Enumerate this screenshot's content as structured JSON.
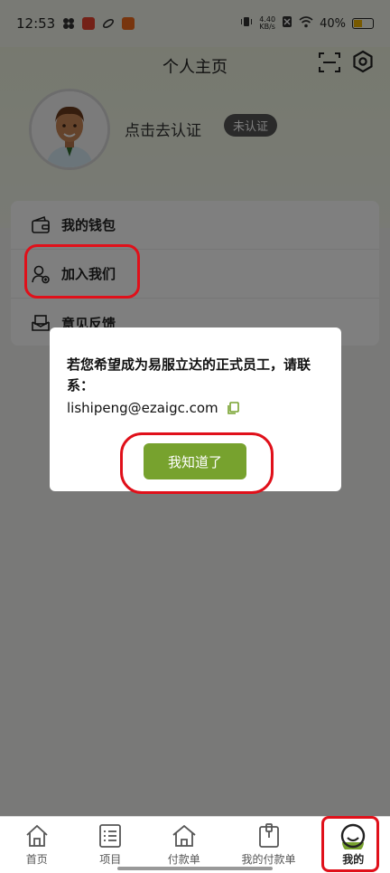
{
  "status_bar": {
    "time": "12:53",
    "net_speed_value": "4.40",
    "net_speed_unit": "KB/s",
    "battery": "40%"
  },
  "header": {
    "title": "个人主页",
    "auth_prompt": "点击去认证",
    "auth_badge": "未认证"
  },
  "menu": {
    "items": [
      {
        "label": "我的钱包",
        "icon": "wallet-icon"
      },
      {
        "label": "加入我们",
        "icon": "user-add-icon"
      },
      {
        "label": "意见反馈",
        "icon": "feedback-icon"
      }
    ]
  },
  "dialog": {
    "message": "若您希望成为易服立达的正式员工，请联系：",
    "email": "lishipeng@ezaigc.com",
    "ok_label": "我知道了"
  },
  "bottom_nav": {
    "items": [
      {
        "label": "首页",
        "icon": "home-icon"
      },
      {
        "label": "项目",
        "icon": "list-icon"
      },
      {
        "label": "付款单",
        "icon": "receipt-home-icon"
      },
      {
        "label": "我的付款单",
        "icon": "clipboard-icon"
      },
      {
        "label": "我的",
        "icon": "smile-icon",
        "active": true
      }
    ]
  },
  "colors": {
    "accent": "#77a22e",
    "annotation": "#e0101a",
    "badge": "#555555"
  }
}
